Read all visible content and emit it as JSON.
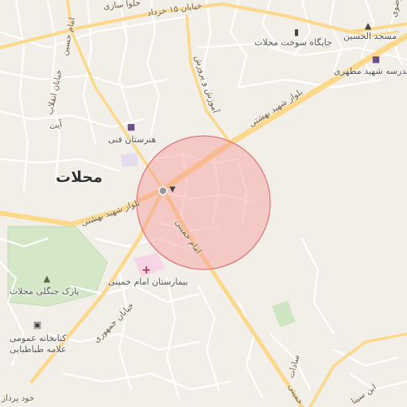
{
  "map": {
    "colors": {
      "background": "#f2efe9",
      "minor_road": "#ffffff",
      "major_road": "#fcd88a",
      "park": "#d4e8c7",
      "hospital": "#f6d6e4",
      "buffer_fill": "#f49a9a",
      "buffer_stroke": "#e07070"
    },
    "city_label": "محلات",
    "places": [
      {
        "id": "vocational-school",
        "label": "هنرستان فنی",
        "icon": "school-icon"
      },
      {
        "id": "fuel-station",
        "label": "جایگاه سوخت محلات",
        "icon": "fuel-station-icon"
      },
      {
        "id": "mosque",
        "label": "مسجد الحسین",
        "icon": "mosque-icon"
      },
      {
        "id": "school",
        "label": "مدرسه شهید مطهری",
        "icon": "school-icon"
      },
      {
        "id": "hospital",
        "label": "بیمارستان امام خمینی",
        "icon": "hospital-icon"
      },
      {
        "id": "park",
        "label": "پارک جنگلی محلات",
        "icon": "tree-icon"
      },
      {
        "id": "library",
        "label": "کتابخانه عمومی علامه طباطبایی",
        "label_line1": "کتابخانه عمومی",
        "label_line2": "علامه طباطبایی",
        "icon": "book-icon"
      }
    ],
    "streets": [
      {
        "id": "beheshti-east",
        "label": "بلوار شهید بهشتی"
      },
      {
        "id": "beheshti-west",
        "label": "بلوار شهید بهشتی"
      },
      {
        "id": "imam-khomeini",
        "label": "امام خمینی"
      },
      {
        "id": "jomhouri",
        "label": "خیابان جمهوری"
      },
      {
        "id": "khordad",
        "label": "خیابان ۱۵ خرداد"
      },
      {
        "id": "halva",
        "label": "حلوا سازی"
      },
      {
        "id": "amoozesh",
        "label": "آموزش و پرورش"
      },
      {
        "id": "enghelab",
        "label": "خیابان انقلاب"
      },
      {
        "id": "imam-hosein",
        "label": "امام حسین"
      },
      {
        "id": "sadat",
        "label": "سادات"
      },
      {
        "id": "ibn-sina",
        "label": "ابن سینا"
      },
      {
        "id": "khodparvar",
        "label": "خود پرداز"
      },
      {
        "id": "khomeini-south",
        "label": "خمینی"
      },
      {
        "id": "ayat",
        "label": "آیت"
      },
      {
        "id": "rezvan",
        "label": "رضوی"
      }
    ]
  }
}
